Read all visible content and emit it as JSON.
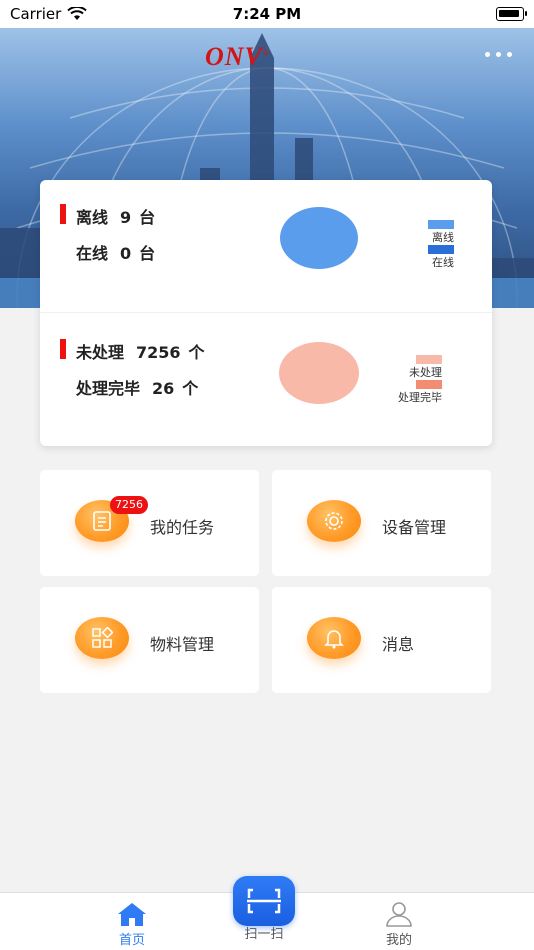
{
  "status_bar": {
    "carrier": "Carrier",
    "time": "7:24 PM"
  },
  "header": {
    "logo": "ONV",
    "logo_mark": "®",
    "more_icon": "more-icon"
  },
  "device_stats": {
    "offline_label": "离线",
    "offline_count": "9",
    "online_label": "在线",
    "online_count": "0",
    "unit": "台",
    "legend": [
      "离线",
      "在线"
    ],
    "colors": {
      "offline": "#5b9ded",
      "online": "#2a6fd8"
    }
  },
  "task_stats": {
    "pending_label": "未处理",
    "pending_count": "7256",
    "done_label": "处理完毕",
    "done_count": "26",
    "unit": "个",
    "legend": [
      "未处理",
      "处理完毕"
    ],
    "colors": {
      "pending": "#f8b9a8",
      "done": "#f28c72"
    }
  },
  "tiles": [
    {
      "label": "我的任务",
      "icon": "task-list-icon",
      "badge": "7256"
    },
    {
      "label": "设备管理",
      "icon": "gear-icon"
    },
    {
      "label": "物料管理",
      "icon": "grid-apps-icon"
    },
    {
      "label": "消息",
      "icon": "bell-icon"
    }
  ],
  "tabbar": {
    "home": "首页",
    "scan": "扫一扫",
    "mine": "我的",
    "active_color": "#2f7bf6"
  }
}
